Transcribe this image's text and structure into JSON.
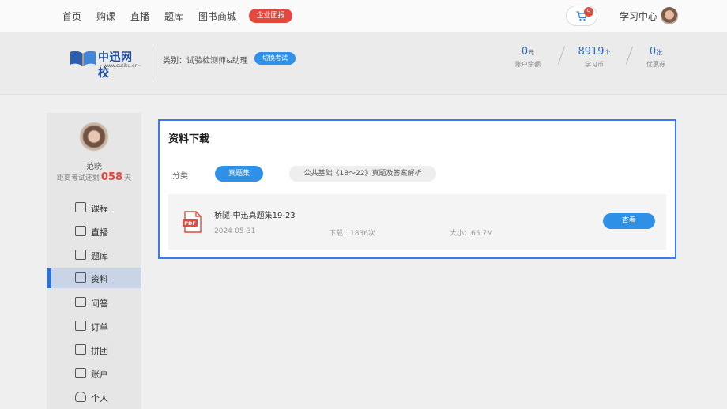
{
  "topnav": {
    "links": [
      "首页",
      "购课",
      "直播",
      "题库",
      "图书商城"
    ],
    "promo": "企业团报",
    "cart_count": "9",
    "study_center": "学习中心"
  },
  "header": {
    "logo_text": "中迅网校",
    "logo_sub": "~www.sutiku.cn~",
    "category": "类别：试验检测师&助理",
    "switch_exam": "切换考试",
    "stats": [
      {
        "value": "0",
        "unit": "元",
        "label": "账户余额"
      },
      {
        "value": "8919",
        "unit": "个",
        "label": "学习币"
      },
      {
        "value": "0",
        "unit": "张",
        "label": "优惠券"
      }
    ]
  },
  "sidebar": {
    "username": "范晓",
    "countdown_prefix": "距离考试还剩",
    "countdown_days": "058",
    "countdown_suffix": "天",
    "items": [
      {
        "label": "课程"
      },
      {
        "label": "直播"
      },
      {
        "label": "题库"
      },
      {
        "label": "资料"
      },
      {
        "label": "问答"
      },
      {
        "label": "订单"
      },
      {
        "label": "拼团"
      },
      {
        "label": "账户"
      },
      {
        "label": "个人"
      }
    ]
  },
  "main": {
    "title": "资料下载",
    "category_label": "分类",
    "chips": [
      "真题集",
      "公共基础《18～22》真题及答案解析"
    ],
    "file": {
      "icon_text": "PDF",
      "name": "桥隧-中迅真题集19-23",
      "date": "2024-05-31",
      "downloads": "下载：1836次",
      "size": "大小：65.7M",
      "view_label": "查看"
    }
  },
  "colors": {
    "accent": "#2e90e6",
    "promo": "#e4483c",
    "panel_border": "#3a7cf0"
  }
}
